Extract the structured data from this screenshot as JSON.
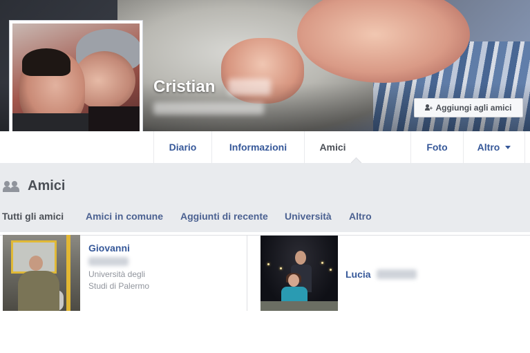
{
  "profile": {
    "name": "Cristian"
  },
  "actions": {
    "add_friend": "Aggiungi agli amici"
  },
  "nav": {
    "tabs": [
      "Diario",
      "Informazioni",
      "Amici",
      "Foto",
      "Altro"
    ],
    "active_tab": "Amici"
  },
  "section": {
    "title": "Amici",
    "subtabs": [
      "Tutti gli amici",
      "Amici in comune",
      "Aggiunti di recente",
      "Università",
      "Altro"
    ],
    "active_subtab": "Tutti gli amici"
  },
  "friends": [
    {
      "name": "Giovanni",
      "detail": "Università degli Studi di Palermo"
    },
    {
      "name": "Lucia",
      "detail": ""
    }
  ],
  "colors": {
    "link": "#365899",
    "text_dark": "#4b4f56",
    "muted": "#90949c",
    "background": "#e9ebee"
  }
}
